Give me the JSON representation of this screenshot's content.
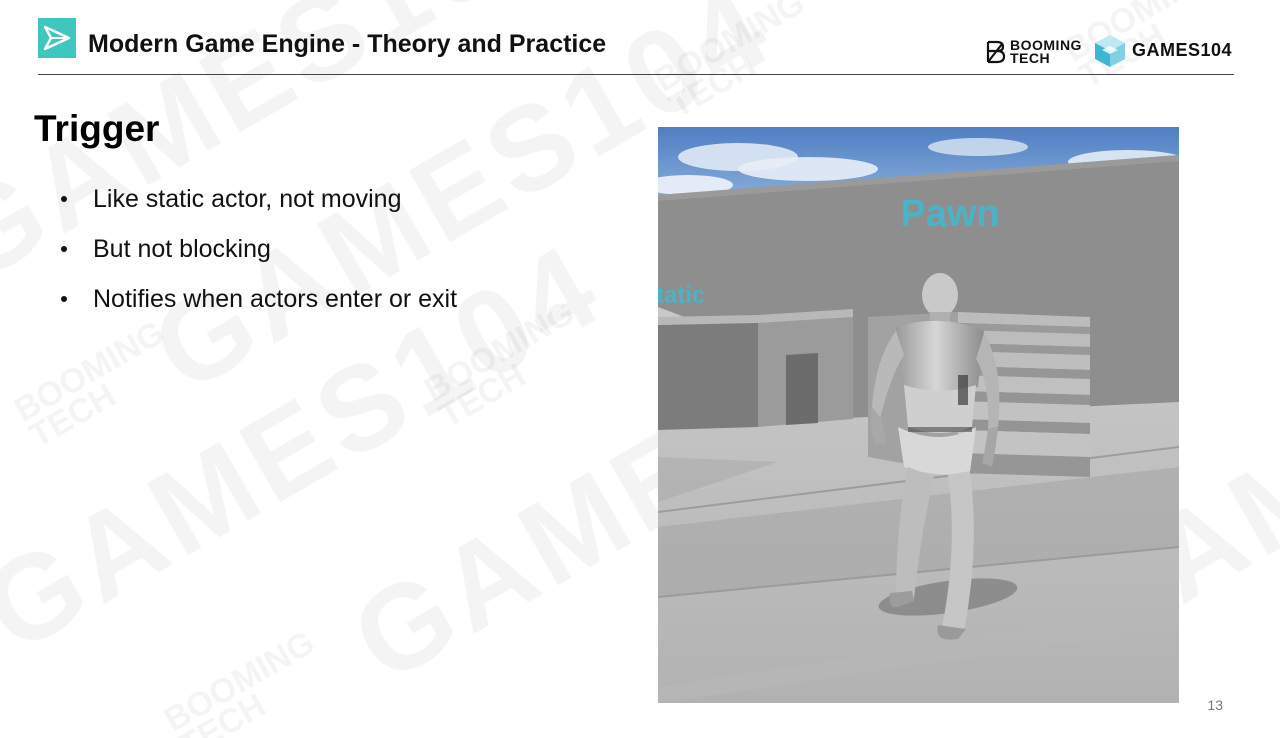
{
  "header": {
    "title": "Modern Game Engine - Theory and Practice",
    "logo_booming": [
      "BOOMING",
      "TECH"
    ],
    "logo_games": "GAMES104"
  },
  "slide": {
    "title": "Trigger",
    "bullets": [
      "Like static actor, not moving",
      "But not blocking",
      "Notifies when actors enter or exit"
    ],
    "page_number": "13"
  },
  "figure": {
    "labels": {
      "pawn": "Pawn",
      "static": "tatic"
    }
  },
  "watermarks": {
    "games": "GAMES104",
    "booming": [
      "BOOMING",
      "TECH"
    ]
  },
  "colors": {
    "accent": "#3fc6bf",
    "label_text": "#4ab3c6",
    "title_text": "#111111"
  }
}
